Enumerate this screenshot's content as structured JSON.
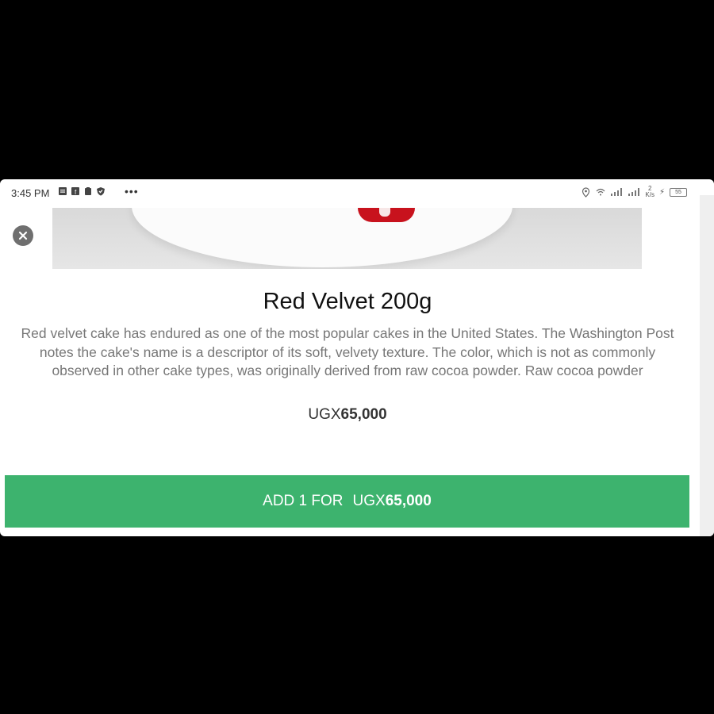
{
  "status_bar": {
    "time": "3:45 PM",
    "network_speed": "2\nK/s",
    "battery": "55"
  },
  "product": {
    "title": "Red Velvet 200g",
    "description": "Red velvet cake has endured as one of the most popular cakes in the United States. The Washington Post notes the cake's name is a descriptor of its soft, velvety texture. The color, which is not as commonly observed in other cake types, was originally derived from raw cocoa powder. Raw cocoa powder",
    "currency": "UGX",
    "price": "65,000"
  },
  "add_button": {
    "prefix": "ADD 1 FOR",
    "currency": "UGX",
    "price": "65,000"
  },
  "colors": {
    "accent": "#3db36e",
    "cake_red": "#c8121d"
  },
  "icons": [
    "close-icon",
    "location-icon",
    "wifi-icon",
    "signal-icon",
    "battery-icon"
  ]
}
